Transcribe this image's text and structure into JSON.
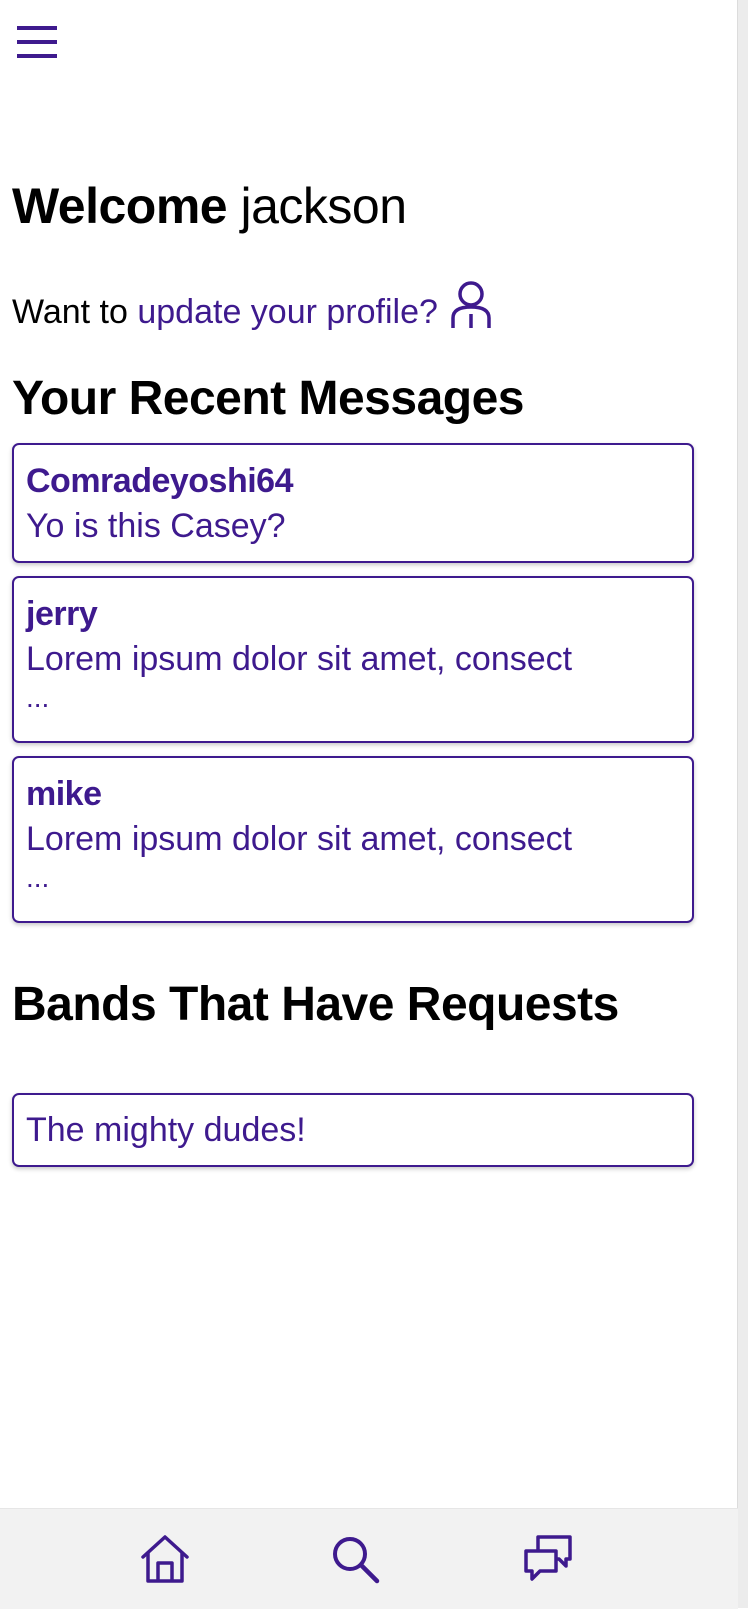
{
  "header": {
    "welcome_word": "Welcome",
    "username": "jackson",
    "menu_icon": "hamburger-menu-icon"
  },
  "profile_prompt": {
    "prefix": "Want to",
    "link_text": "update your profile?",
    "icon": "user-icon"
  },
  "messages": {
    "title": "Your Recent Messages",
    "items": [
      {
        "sender": "Comradeyoshi64",
        "preview": "Yo is this Casey?",
        "more": ""
      },
      {
        "sender": "jerry",
        "preview": "Lorem ipsum dolor sit amet, consect",
        "more": "..."
      },
      {
        "sender": "mike",
        "preview": "Lorem ipsum dolor sit amet, consect",
        "more": "..."
      }
    ]
  },
  "bands": {
    "title": "Bands That Have Requests",
    "items": [
      {
        "name": "The mighty dudes!"
      }
    ]
  },
  "bottom_nav": {
    "items": [
      {
        "icon": "home-icon"
      },
      {
        "icon": "search-icon"
      },
      {
        "icon": "chat-icon"
      }
    ]
  },
  "colors": {
    "accent": "#3e1a8e",
    "text": "#000000",
    "nav_background": "#f2f2f2"
  }
}
